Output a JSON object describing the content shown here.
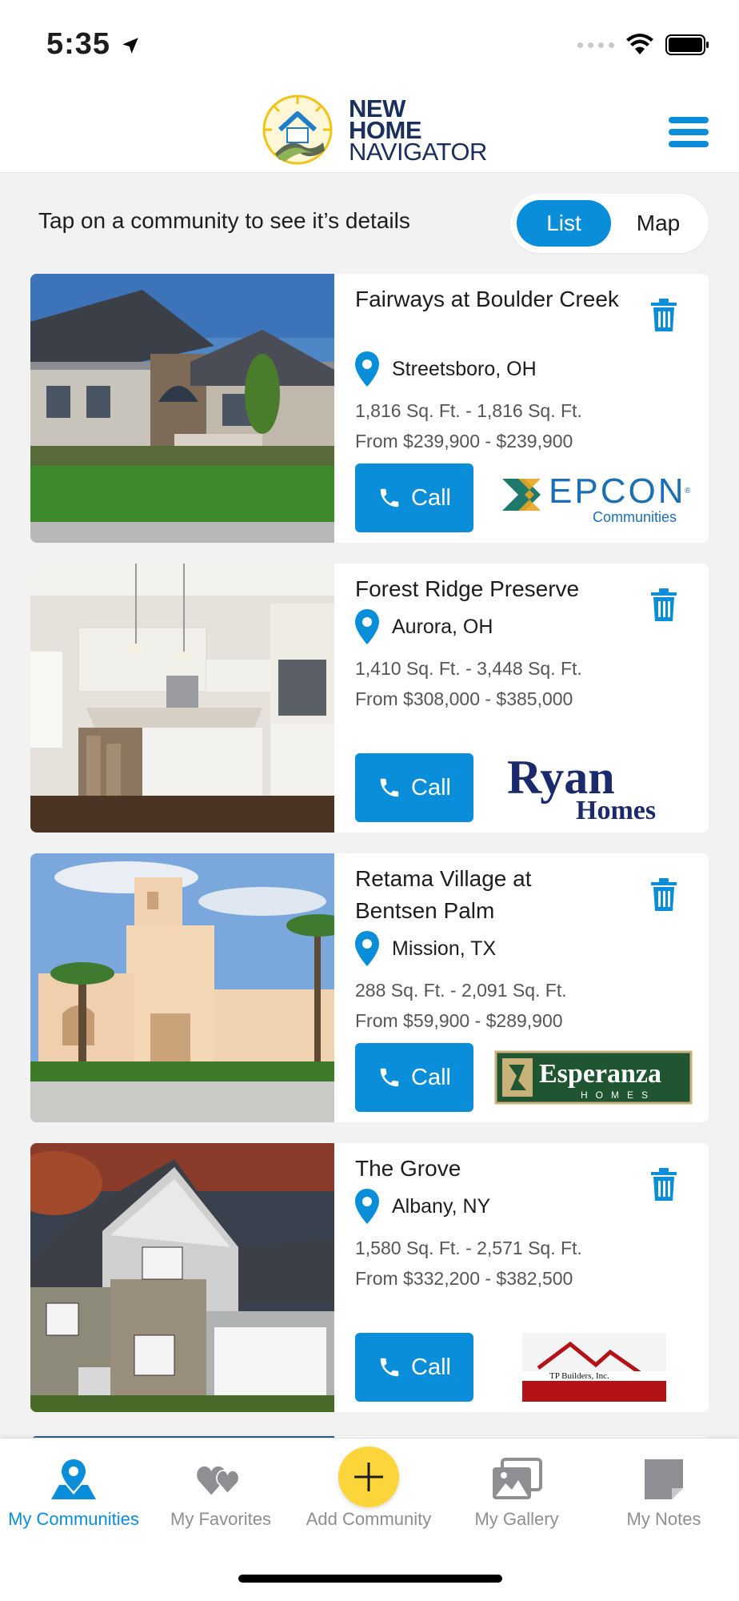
{
  "status_bar": {
    "time": "5:35"
  },
  "header": {
    "logo_lines": [
      "NEW",
      "HOME",
      "NAVIGATOR"
    ]
  },
  "instructions": "Tap on a community to see it’s details",
  "view_toggle": {
    "list": "List",
    "map": "Map",
    "selected": "List"
  },
  "colors": {
    "accent": "#0a8ed9",
    "add_button": "#fcd53a",
    "inactive_tab": "#8e8e93"
  },
  "communities": [
    {
      "name": "Fairways at Boulder Creek",
      "location": "Streetsboro, OH",
      "sqft": "1,816 Sq. Ft. - 1,816 Sq. Ft.",
      "price": "From $239,900 - $239,900",
      "call_label": "Call",
      "builder": "EPCON",
      "builder_sub": "Communities"
    },
    {
      "name": "Forest Ridge Preserve",
      "location": "Aurora, OH",
      "sqft": "1,410 Sq. Ft. - 3,448 Sq. Ft.",
      "price": "From $308,000 - $385,000",
      "call_label": "Call",
      "builder": "Ryan",
      "builder_sub": "Homes"
    },
    {
      "name": "Retama Village at Bentsen Palm",
      "location": "Mission, TX",
      "sqft": "288 Sq. Ft. - 2,091 Sq. Ft.",
      "price": "From $59,900 - $289,900",
      "call_label": "Call",
      "builder": "Esperanza",
      "builder_sub": "HOMES"
    },
    {
      "name": "The Grove",
      "location": "Albany, NY",
      "sqft": "1,580 Sq. Ft. - 2,571 Sq. Ft.",
      "price": "From $332,200 - $382,500",
      "call_label": "Call",
      "builder": "TP Builders, Inc."
    }
  ],
  "tabs": [
    {
      "label": "My Communities",
      "icon": "map-pin-person-icon",
      "active": true
    },
    {
      "label": "My Favorites",
      "icon": "hearts-icon",
      "active": false
    },
    {
      "label": "Add Community",
      "icon": "plus-icon",
      "active": false
    },
    {
      "label": "My Gallery",
      "icon": "photos-icon",
      "active": false
    },
    {
      "label": "My Notes",
      "icon": "note-icon",
      "active": false
    }
  ]
}
